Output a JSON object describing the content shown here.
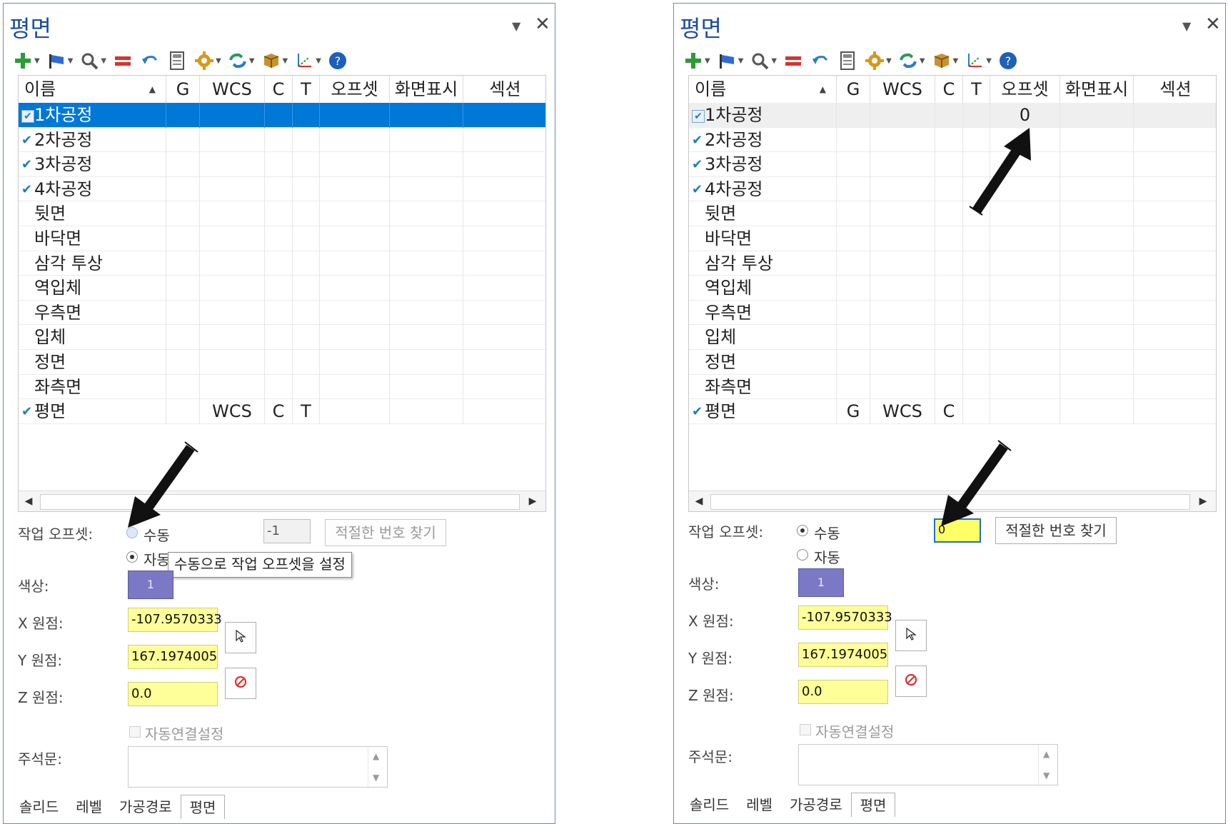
{
  "colors": {
    "accent": "#0078d7",
    "title": "#1f4e9c",
    "yellow_field": "#ffff99",
    "swatch": "#7b78c6"
  },
  "panels": [
    {
      "title": "평면",
      "columns": {
        "name": "이름",
        "g": "G",
        "wcs": "WCS",
        "c": "C",
        "t": "T",
        "offset": "오프셋",
        "display": "화면표시",
        "section": "섹션"
      },
      "rows": [
        {
          "name": "1차공정",
          "checked": true,
          "g": "",
          "wcs": "",
          "c": "",
          "t": "",
          "offset": ""
        },
        {
          "name": "2차공정",
          "checked": true,
          "g": "",
          "wcs": "",
          "c": "",
          "t": "",
          "offset": ""
        },
        {
          "name": "3차공정",
          "checked": true,
          "g": "",
          "wcs": "",
          "c": "",
          "t": "",
          "offset": ""
        },
        {
          "name": "4차공정",
          "checked": true,
          "g": "",
          "wcs": "",
          "c": "",
          "t": "",
          "offset": ""
        },
        {
          "name": "뒷면",
          "checked": false,
          "g": "",
          "wcs": "",
          "c": "",
          "t": "",
          "offset": ""
        },
        {
          "name": "바닥면",
          "checked": false,
          "g": "",
          "wcs": "",
          "c": "",
          "t": "",
          "offset": ""
        },
        {
          "name": "삼각 투상",
          "checked": false,
          "g": "",
          "wcs": "",
          "c": "",
          "t": "",
          "offset": ""
        },
        {
          "name": "역입체",
          "checked": false,
          "g": "",
          "wcs": "",
          "c": "",
          "t": "",
          "offset": ""
        },
        {
          "name": "우측면",
          "checked": false,
          "g": "",
          "wcs": "",
          "c": "",
          "t": "",
          "offset": ""
        },
        {
          "name": "입체",
          "checked": false,
          "g": "",
          "wcs": "",
          "c": "",
          "t": "",
          "offset": ""
        },
        {
          "name": "정면",
          "checked": false,
          "g": "",
          "wcs": "",
          "c": "",
          "t": "",
          "offset": ""
        },
        {
          "name": "좌측면",
          "checked": false,
          "g": "",
          "wcs": "",
          "c": "",
          "t": "",
          "offset": ""
        },
        {
          "name": "평면",
          "checked": true,
          "g": "",
          "wcs": "WCS",
          "c": "C",
          "t": "T",
          "offset": ""
        }
      ],
      "form": {
        "work_offset_label": "작업 오프셋:",
        "manual_label": "수동",
        "auto_label": "자동",
        "offset_value": "-1",
        "find_button": "적절한 번호 찾기",
        "color_label": "색상:",
        "color_value": "1",
        "x_label": "X 원점:",
        "x_value": "-107.9570333",
        "y_label": "Y 원점:",
        "y_value": "167.1974005",
        "z_label": "Z 원점:",
        "z_value": "0.0",
        "auto_link_label": "자동연결설정",
        "memo_label": "주석문:",
        "tooltip": "수동으로 작업 오프셋을 설정"
      },
      "tabs": [
        "솔리드",
        "레벨",
        "가공경로",
        "평면"
      ]
    },
    {
      "title": "평면",
      "columns": {
        "name": "이름",
        "g": "G",
        "wcs": "WCS",
        "c": "C",
        "t": "T",
        "offset": "오프셋",
        "display": "화면표시",
        "section": "섹션"
      },
      "rows": [
        {
          "name": "1차공정",
          "checked": true,
          "g": "",
          "wcs": "",
          "c": "",
          "t": "",
          "offset": "0"
        },
        {
          "name": "2차공정",
          "checked": true,
          "g": "",
          "wcs": "",
          "c": "",
          "t": "",
          "offset": ""
        },
        {
          "name": "3차공정",
          "checked": true,
          "g": "",
          "wcs": "",
          "c": "",
          "t": "",
          "offset": ""
        },
        {
          "name": "4차공정",
          "checked": true,
          "g": "",
          "wcs": "",
          "c": "",
          "t": "",
          "offset": ""
        },
        {
          "name": "뒷면",
          "checked": false,
          "g": "",
          "wcs": "",
          "c": "",
          "t": "",
          "offset": ""
        },
        {
          "name": "바닥면",
          "checked": false,
          "g": "",
          "wcs": "",
          "c": "",
          "t": "",
          "offset": ""
        },
        {
          "name": "삼각 투상",
          "checked": false,
          "g": "",
          "wcs": "",
          "c": "",
          "t": "",
          "offset": ""
        },
        {
          "name": "역입체",
          "checked": false,
          "g": "",
          "wcs": "",
          "c": "",
          "t": "",
          "offset": ""
        },
        {
          "name": "우측면",
          "checked": false,
          "g": "",
          "wcs": "",
          "c": "",
          "t": "",
          "offset": ""
        },
        {
          "name": "입체",
          "checked": false,
          "g": "",
          "wcs": "",
          "c": "",
          "t": "",
          "offset": ""
        },
        {
          "name": "정면",
          "checked": false,
          "g": "",
          "wcs": "",
          "c": "",
          "t": "",
          "offset": ""
        },
        {
          "name": "좌측면",
          "checked": false,
          "g": "",
          "wcs": "",
          "c": "",
          "t": "",
          "offset": ""
        },
        {
          "name": "평면",
          "checked": true,
          "g": "G",
          "wcs": "WCS",
          "c": "C",
          "t": "",
          "offset": ""
        }
      ],
      "form": {
        "work_offset_label": "작업 오프셋:",
        "manual_label": "수동",
        "auto_label": "자동",
        "offset_value": "0",
        "find_button": "적절한 번호 찾기",
        "color_label": "색상:",
        "color_value": "1",
        "x_label": "X 원점:",
        "x_value": "-107.9570333",
        "y_label": "Y 원점:",
        "y_value": "167.1974005",
        "z_label": "Z 원점:",
        "z_value": "0.0",
        "auto_link_label": "자동연결설정",
        "memo_label": "주석문:"
      },
      "tabs": [
        "솔리드",
        "레벨",
        "가공경로",
        "평면"
      ]
    }
  ],
  "toolbar_icons": [
    "add-icon",
    "flag-icon",
    "zoom-icon",
    "equal-icon",
    "undo-icon",
    "calculator-icon",
    "gear-icon",
    "refresh-icon",
    "box-icon",
    "axis-icon",
    "help-icon"
  ]
}
